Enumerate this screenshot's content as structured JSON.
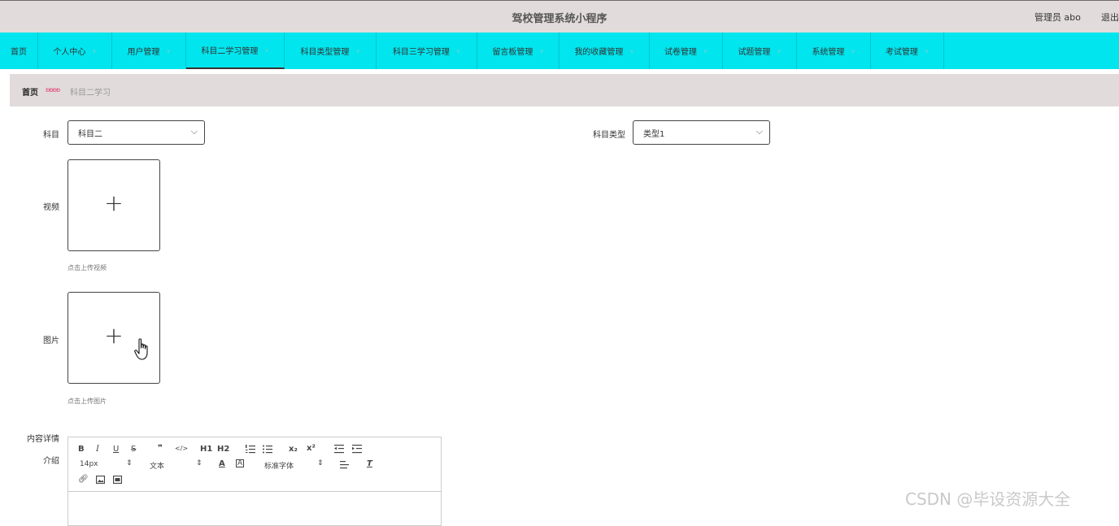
{
  "header": {
    "title": "驾校管理系统小程序",
    "admin": "管理员 abo",
    "logout": "退出"
  },
  "nav": {
    "items": [
      {
        "label": "首页",
        "has_dropdown": false
      },
      {
        "label": "个人中心",
        "has_dropdown": true
      },
      {
        "label": "用户管理",
        "has_dropdown": true
      },
      {
        "label": "科目二学习管理",
        "has_dropdown": true,
        "active": true
      },
      {
        "label": "科目类型管理",
        "has_dropdown": true
      },
      {
        "label": "科目三学习管理",
        "has_dropdown": true
      },
      {
        "label": "留言板管理",
        "has_dropdown": true
      },
      {
        "label": "我的收藏管理",
        "has_dropdown": true
      },
      {
        "label": "试卷管理",
        "has_dropdown": true
      },
      {
        "label": "试题管理",
        "has_dropdown": true
      },
      {
        "label": "系统管理",
        "has_dropdown": true
      },
      {
        "label": "考试管理",
        "has_dropdown": true
      }
    ],
    "background": "#00e5ee"
  },
  "breadcrumb": {
    "home": "首页",
    "current": "科目二学习"
  },
  "form": {
    "subject": {
      "label": "科目",
      "value": "科目二"
    },
    "subject_type": {
      "label": "科目类型",
      "value": "类型1"
    },
    "video": {
      "label": "视频",
      "hint": "点击上传视频"
    },
    "image": {
      "label": "图片",
      "hint": "点击上传图片"
    },
    "content": {
      "label_line1": "内容详情",
      "label_line2": "介绍"
    }
  },
  "editor": {
    "toolbar_row1": [
      "B",
      "I",
      "U",
      "S",
      "❞",
      "</>",
      "H1",
      "H2",
      "ordered-list",
      "bullet-list",
      "x₂",
      "x²",
      "outdent",
      "indent"
    ],
    "font_size": "14px",
    "paragraph": "文本",
    "font_family": "标准字体"
  },
  "watermark": "CSDN @毕设资源大全"
}
